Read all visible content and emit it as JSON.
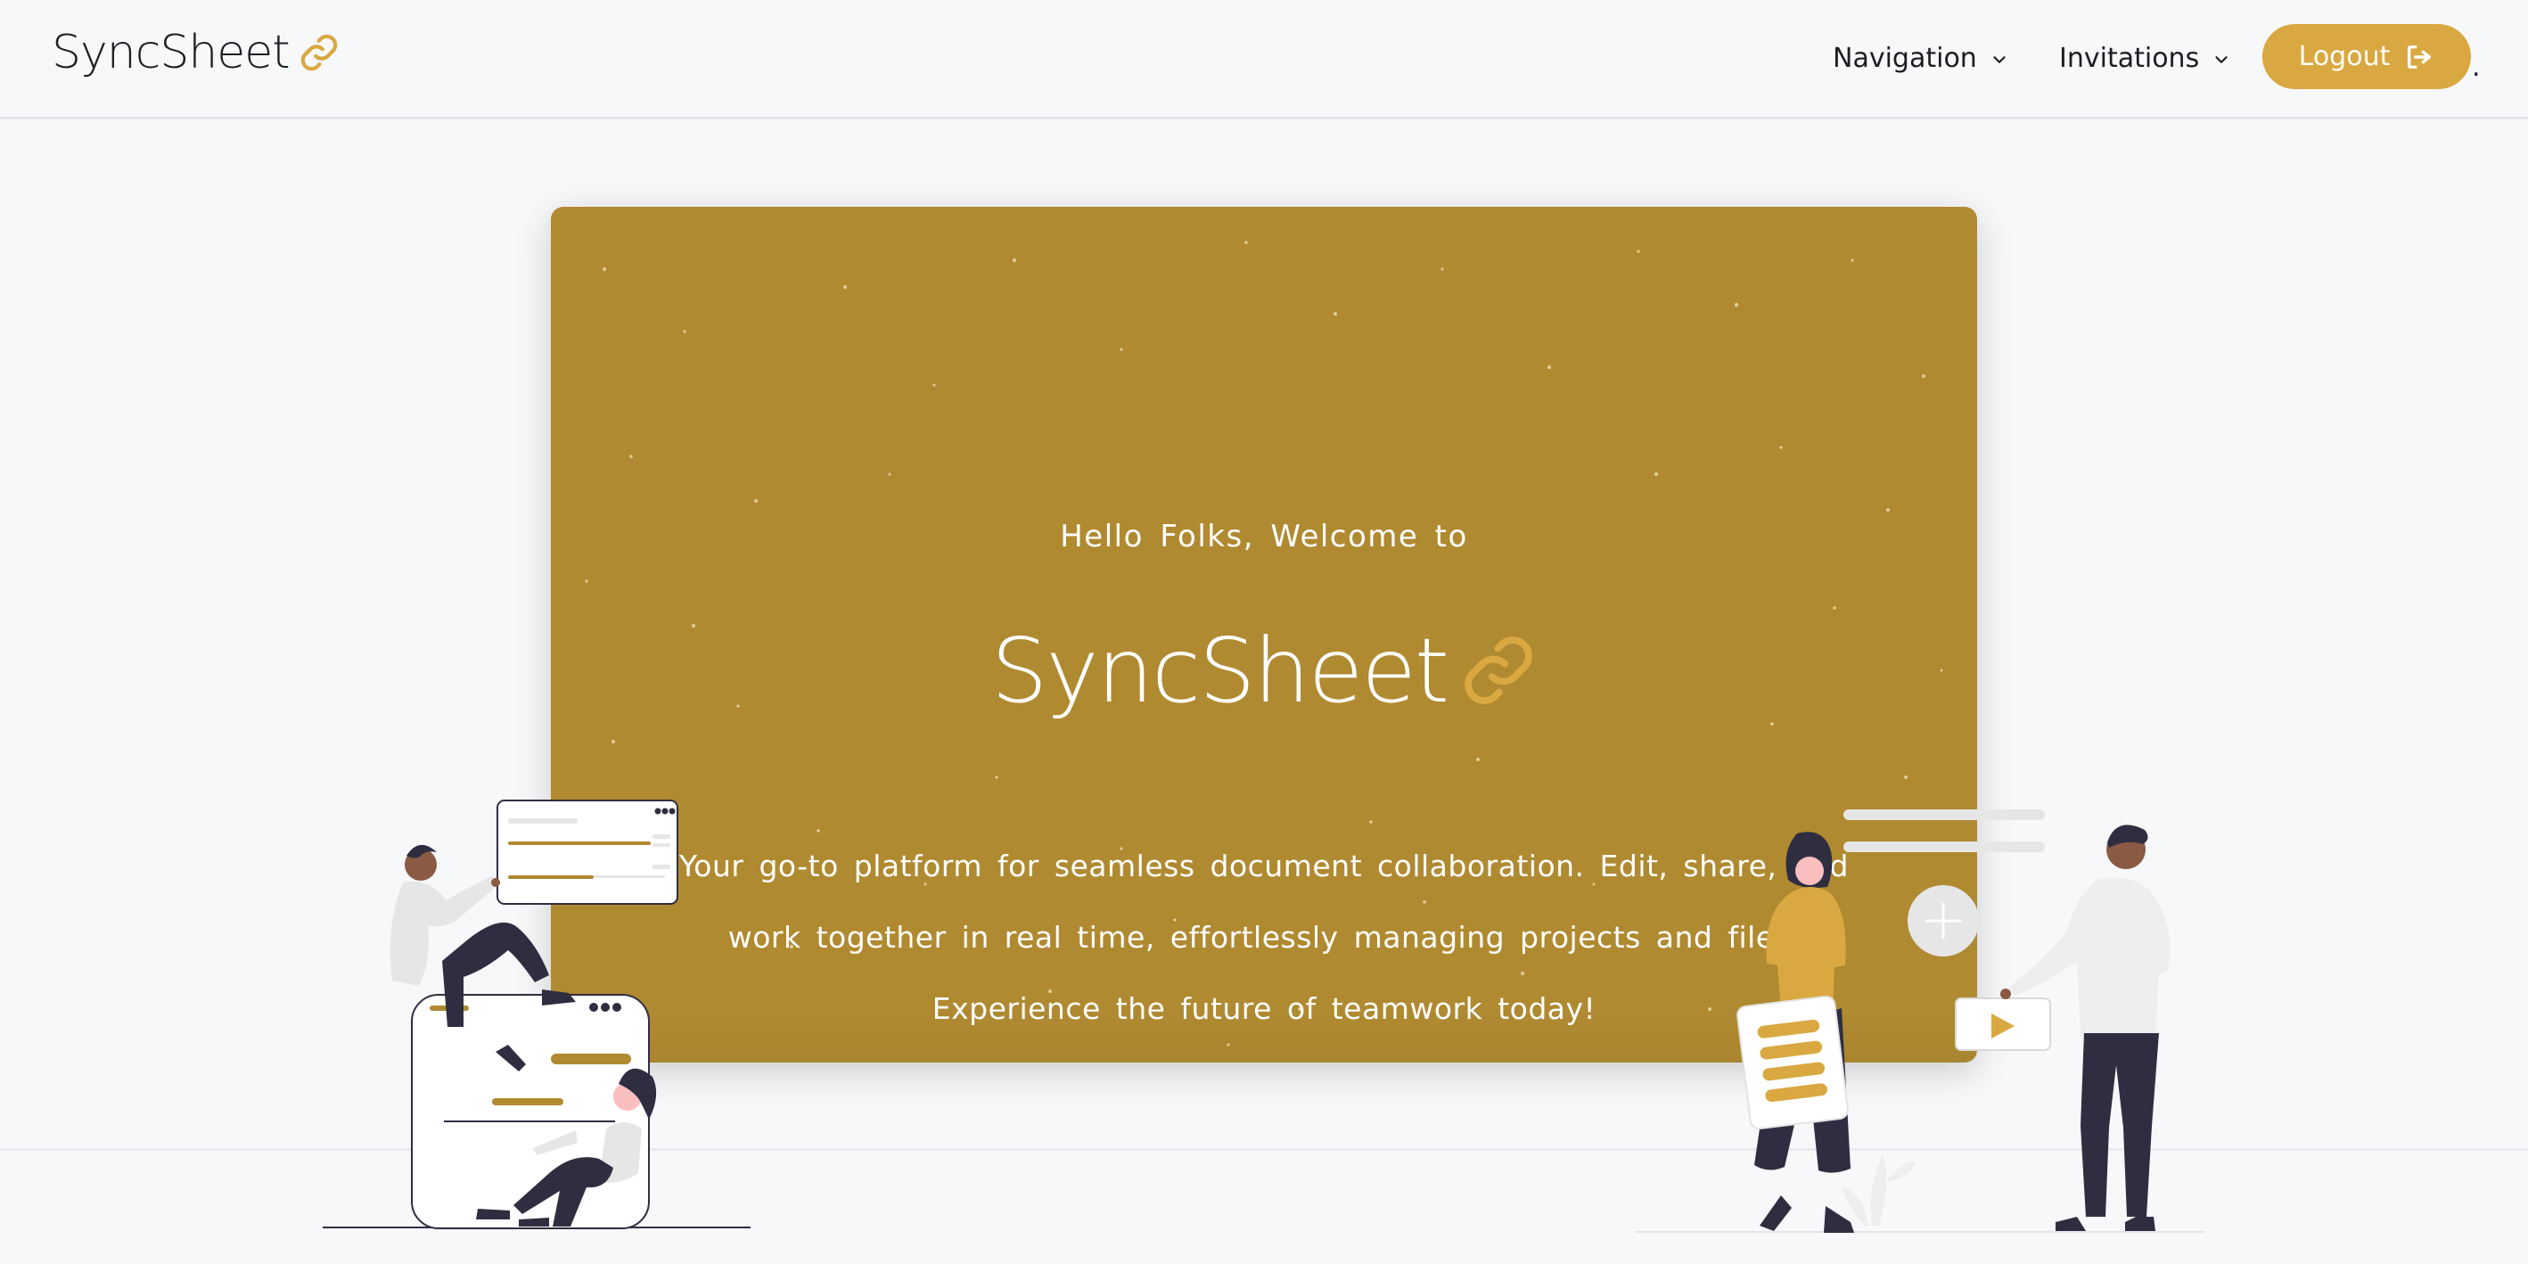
{
  "navbar": {
    "brand": "SyncSheet",
    "brand_icon": "link-icon",
    "items": [
      {
        "label": "Navigation",
        "icon": "chevron-down-icon"
      },
      {
        "label": "Invitations",
        "icon": "chevron-down-icon"
      }
    ],
    "logout": {
      "label": "Logout",
      "icon": "logout-icon"
    },
    "trailing": "."
  },
  "hero": {
    "greeting": "Hello Folks, Welcome to",
    "title": "SyncSheet",
    "title_icon": "link-icon",
    "description": "Your go-to platform for seamless document collaboration. Edit, share, and work together in real time, effortlessly managing projects and files. Experience the future of teamwork today!"
  },
  "colors": {
    "accent": "#d9a841",
    "hero_bg": "#b08a31",
    "page_bg": "#f7f8fa",
    "text_dark": "#1d1d22",
    "figure_dark": "#2f2e41",
    "figure_light": "#e6e6e6"
  }
}
